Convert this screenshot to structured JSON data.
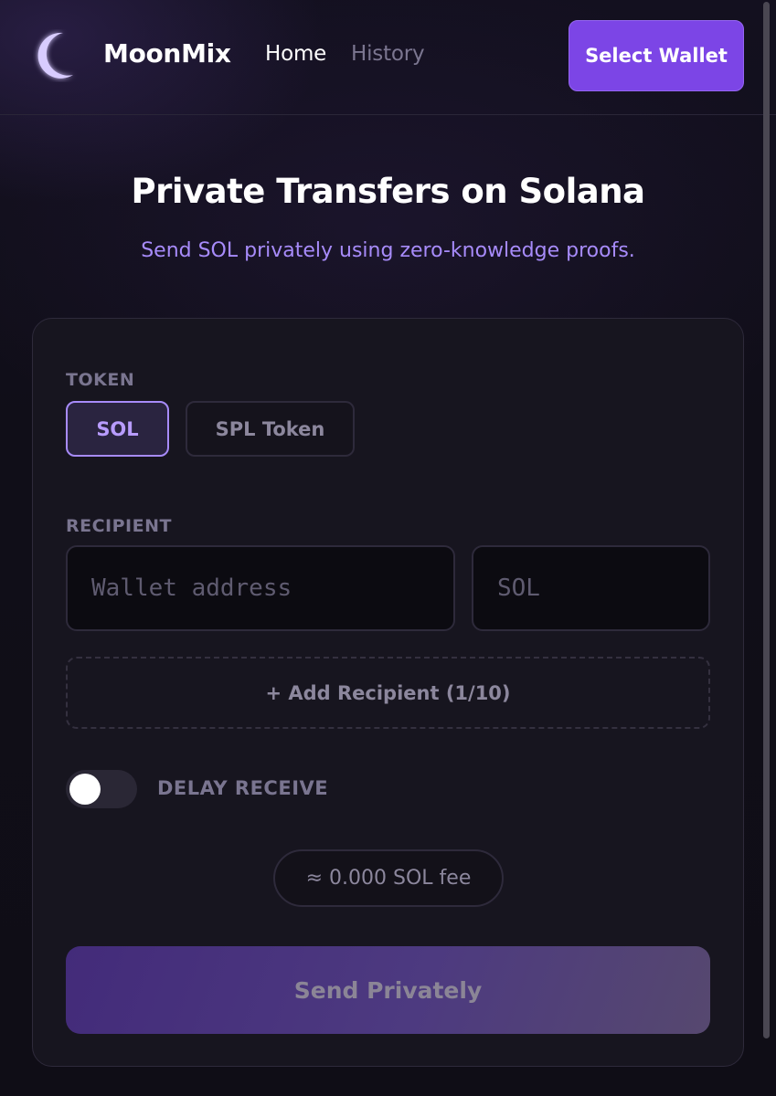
{
  "header": {
    "brand": "MoonMix",
    "logo_icon": "crescent-moon-icon",
    "nav": {
      "home": "Home",
      "history": "History"
    },
    "select_wallet": "Select Wallet"
  },
  "hero": {
    "title": "Private Transfers on Solana",
    "subtitle": "Send SOL privately using zero-knowledge proofs."
  },
  "form": {
    "token_label": "TOKEN",
    "token_options": [
      "SOL",
      "SPL Token"
    ],
    "selected_token": "SOL",
    "recipient_label": "RECIPIENT",
    "wallet_placeholder": "Wallet address",
    "amount_placeholder": "SOL",
    "add_recipient": "+ Add Recipient (1/10)",
    "delay_receive_label": "DELAY RECEIVE",
    "delay_receive_on": false,
    "fee": "≈ 0.000 SOL fee",
    "send_button": "Send Privately"
  },
  "colors": {
    "accent": "#7c45e6",
    "accent_light": "#a78bfa",
    "background": "#0f0d17",
    "card": "#17151f"
  }
}
